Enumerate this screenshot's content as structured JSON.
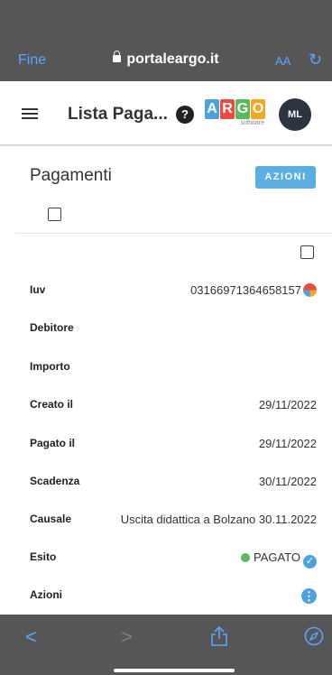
{
  "browser": {
    "done_label": "Fine",
    "url": "portaleargo.it",
    "text_size_label": "AA"
  },
  "header": {
    "title": "Lista Paga...",
    "help_glyph": "?",
    "logo_letters": [
      "A",
      "R",
      "G",
      "O"
    ],
    "logo_colors": [
      "#4aa3df",
      "#e84c3d",
      "#5cb85c",
      "#f5a623"
    ],
    "logo_sub": "software",
    "avatar_initials": "ML"
  },
  "section": {
    "title": "Pagamenti",
    "actions_label": "AZIONI"
  },
  "details": [
    {
      "label": "Iuv",
      "value": "03166971364658157"
    },
    {
      "label": "Debitore",
      "value": ""
    },
    {
      "label": "Importo",
      "value": ""
    },
    {
      "label": "Creato il",
      "value": "29/11/2022"
    },
    {
      "label": "Pagato il",
      "value": "29/11/2022"
    },
    {
      "label": "Scadenza",
      "value": "30/11/2022"
    },
    {
      "label": "Causale",
      "value": "Uscita didattica a Bolzano 30.11.2022"
    },
    {
      "label": "Esito",
      "value": "PAGATO"
    },
    {
      "label": "Azioni",
      "value": ""
    }
  ],
  "colors": {
    "accent": "#5aaee2",
    "chrome": "#565656",
    "link": "#5aa6ff",
    "success": "#5cb85c"
  }
}
